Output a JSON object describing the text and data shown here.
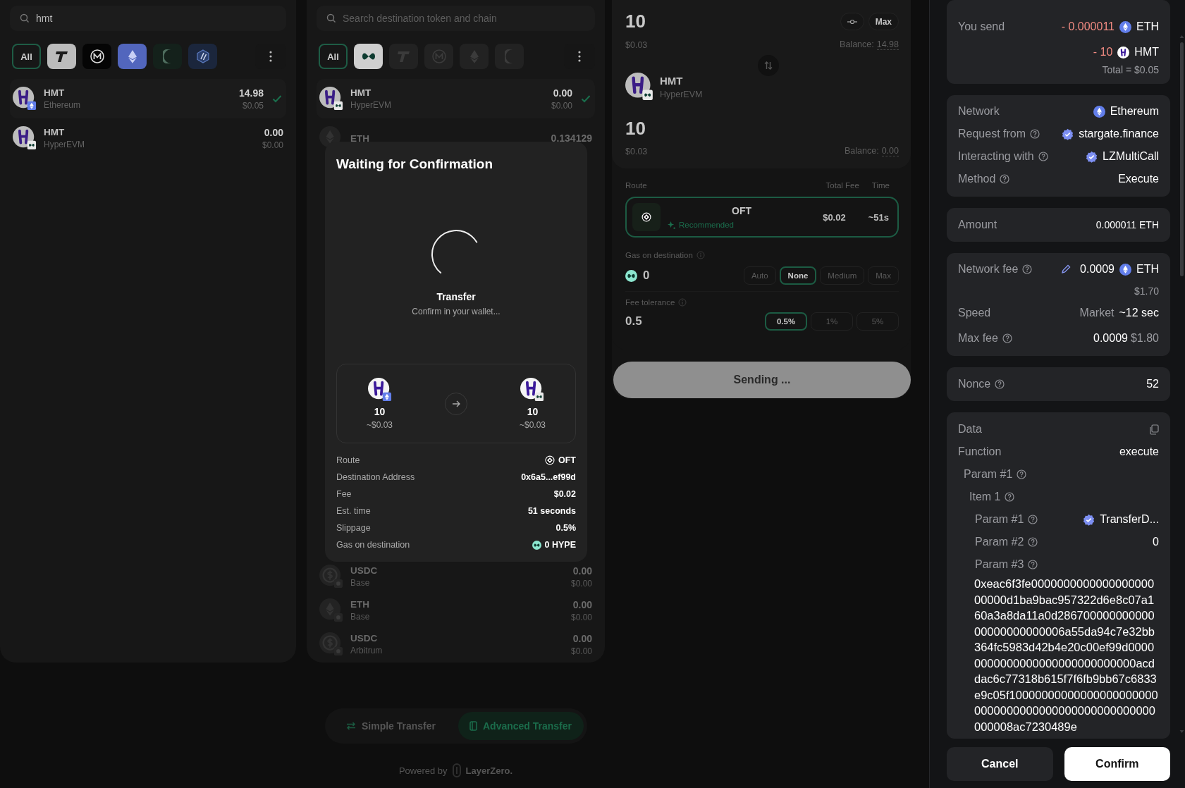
{
  "source_panel": {
    "search": {
      "value": "hmt"
    },
    "filters": [
      {
        "kind": "all",
        "label": "All",
        "selected": true,
        "disabled": false
      },
      {
        "kind": "t-logo",
        "selected": false,
        "disabled": false
      },
      {
        "kind": "m-logo",
        "selected": false,
        "disabled": false
      },
      {
        "kind": "ethereum",
        "selected": false,
        "disabled": false
      },
      {
        "kind": "crescent",
        "selected": false,
        "disabled": false
      },
      {
        "kind": "arbitrum",
        "selected": false,
        "disabled": false
      }
    ],
    "tokens": [
      {
        "kind": "hmt-ethereum",
        "symbol": "HMT",
        "network": "Ethereum",
        "amount": "14.98",
        "usd": "$0.05",
        "selected": true,
        "available": true
      },
      {
        "kind": "hmt-hyperevm",
        "symbol": "HMT",
        "network": "HyperEVM",
        "amount": "0.00",
        "usd": "$0.00",
        "selected": false,
        "available": true
      }
    ]
  },
  "destination_panel": {
    "search": {
      "placeholder": "Search destination token and chain"
    },
    "filters": [
      {
        "kind": "all",
        "label": "All",
        "selected": true,
        "disabled": false
      },
      {
        "kind": "hyperevm",
        "selected": false,
        "disabled": false
      },
      {
        "kind": "t-logo",
        "selected": false,
        "disabled": true
      },
      {
        "kind": "m-logo",
        "selected": false,
        "disabled": true
      },
      {
        "kind": "ethereum",
        "selected": false,
        "disabled": true
      },
      {
        "kind": "crescent",
        "selected": false,
        "disabled": true
      }
    ],
    "tokens": [
      {
        "kind": "hmt-hyperevm",
        "symbol": "HMT",
        "network": "HyperEVM",
        "amount": "0.00",
        "usd": "$0.00",
        "selected": true,
        "available": true
      },
      {
        "kind": "eth",
        "symbol": "ETH",
        "amount": "0.134129",
        "selected": false,
        "available": false
      }
    ],
    "tokens_below_dialog": [
      {
        "kind": "usdc-base",
        "symbol": "USDC",
        "network": "Base",
        "amount": "0.00",
        "usd": "$0.00",
        "selected": false,
        "available": false
      },
      {
        "kind": "eth-base",
        "symbol": "ETH",
        "network": "Base",
        "amount": "0.00",
        "usd": "$0.00",
        "selected": false,
        "available": false
      },
      {
        "kind": "usdc-arbitrum",
        "symbol": "USDC",
        "network": "Arbitrum",
        "amount": "0.00",
        "usd": "$0.00",
        "selected": false,
        "available": false
      }
    ]
  },
  "amount_panel": {
    "from": {
      "amount": "10",
      "usd": "$0.03",
      "max_label": "Max",
      "balance_label": "Balance:",
      "balance": "14.98"
    },
    "to": {
      "kind": "hmt-hyperevm",
      "symbol": "HMT",
      "network": "HyperEVM",
      "amount": "10",
      "usd": "$0.03",
      "balance_label": "Balance:",
      "balance": "0.00"
    },
    "route_header": {
      "route": "Route",
      "fee": "Total Fee",
      "time": "Time"
    },
    "routes": [
      {
        "name": "OFT",
        "tag": "Recommended",
        "fee": "$0.02",
        "time": "~51s",
        "selected": true
      }
    ],
    "gas": {
      "label": "Gas on destination",
      "value": "0",
      "options": [
        {
          "label": "Auto",
          "selected": false
        },
        {
          "label": "None",
          "selected": true
        },
        {
          "label": "Medium",
          "selected": false
        },
        {
          "label": "Max",
          "selected": false
        }
      ]
    },
    "fee_tolerance": {
      "label": "Fee tolerance",
      "value": "0.5",
      "options": [
        {
          "label": "0.5%",
          "selected": true
        },
        {
          "label": "1%",
          "selected": false
        },
        {
          "label": "5%",
          "selected": false
        }
      ]
    },
    "submit": {
      "label": "Sending ...",
      "disabled": true
    }
  },
  "dialog": {
    "title": "Waiting for Confirmation",
    "step": "Transfer",
    "message": "Confirm in your wallet...",
    "from": {
      "kind": "hmt-ethereum",
      "amount": "10",
      "usd": "~$0.03"
    },
    "to": {
      "kind": "hmt-hyperevm",
      "amount": "10",
      "usd": "~$0.03"
    },
    "details": [
      {
        "label": "Route",
        "kind": "oft",
        "value": "OFT"
      },
      {
        "label": "Destination Address",
        "value": "0x6a5...ef99d"
      },
      {
        "label": "Fee",
        "value": "$0.02"
      },
      {
        "label": "Est. time",
        "value": "51 seconds"
      },
      {
        "label": "Slippage",
        "value": "0.5%"
      },
      {
        "label": "Gas on destination",
        "kind": "hype",
        "value": "0 HYPE"
      }
    ]
  },
  "mode_switch": [
    {
      "kind": "simple",
      "label": "Simple Transfer",
      "selected": false
    },
    {
      "kind": "advanced",
      "label": "Advanced Transfer",
      "selected": true
    }
  ],
  "footer": {
    "powered_by": "Powered by",
    "brand": "LayerZero."
  },
  "wallet": {
    "you_send": {
      "label": "You send",
      "items": [
        {
          "amount": "- 0.000011",
          "kind": "ethereum",
          "token": "ETH"
        },
        {
          "amount": "- 10",
          "kind": "hmt",
          "token": "HMT"
        }
      ],
      "total": "Total = $0.05"
    },
    "request": [
      {
        "label": "Network",
        "help": false,
        "kind": "ethereum",
        "value": "Ethereum"
      },
      {
        "label": "Request from",
        "help": true,
        "kind": "verified",
        "value": "stargate.finance"
      },
      {
        "label": "Interacting with",
        "help": true,
        "kind": "verified",
        "value": "LZMultiCall"
      },
      {
        "label": "Method",
        "help": true,
        "value": "Execute"
      }
    ],
    "amount": {
      "label": "Amount",
      "value": "0.000011 ETH"
    },
    "fee": {
      "label": "Network fee",
      "help": true,
      "value": "0.0009",
      "token": "ETH",
      "usd": "$1.70",
      "speed_label": "Speed",
      "speed": "Market",
      "speed_time": "~12 sec",
      "max_label": "Max fee",
      "max_help": true,
      "max_value": "0.0009",
      "max_usd": "$1.80"
    },
    "nonce": {
      "label": "Nonce",
      "help": true,
      "value": "52"
    },
    "data": {
      "label": "Data",
      "function_label": "Function",
      "function": "execute",
      "params": [
        {
          "label": "Param #1",
          "help": true,
          "children": [
            {
              "label": "Item 1",
              "help": true,
              "children": [
                {
                  "label": "Param #1",
                  "help": true,
                  "kind": "verified",
                  "value": "TransferD..."
                },
                {
                  "label": "Param #2",
                  "help": true,
                  "value": "0"
                },
                {
                  "label": "Param #3",
                  "help": true,
                  "kind": "block",
                  "value": "0xeac6f3fe000000000000000000000000d1ba9bac957322d6e8c07a160a3a8da11a0d28670000000000000000000000006a55da94c7e32bb364fc5983d42b4e20c00ef99d00000000000000000000000000000acddac6c77318b615f7f6fb9bb67c6833e9c05f100000000000000000000000000000000000000000000000000000008ac7230489e"
                }
              ]
            }
          ]
        }
      ]
    },
    "actions": [
      {
        "kind": "secondary",
        "label": "Cancel"
      },
      {
        "kind": "primary",
        "label": "Confirm"
      }
    ]
  }
}
